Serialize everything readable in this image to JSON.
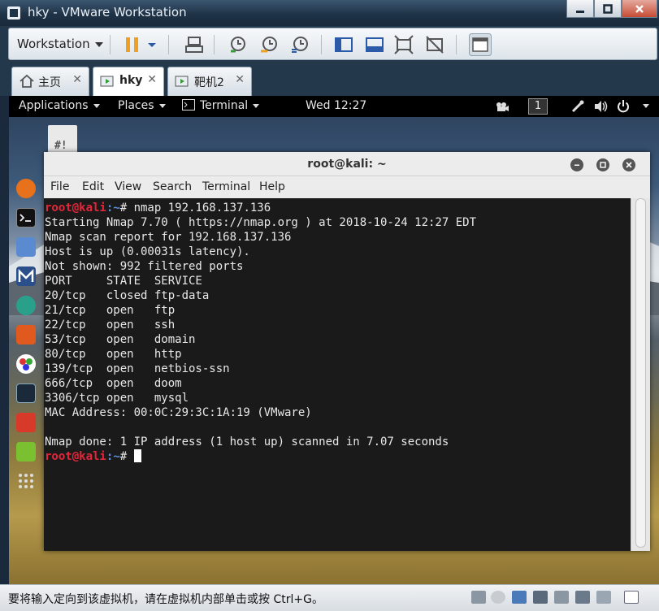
{
  "window": {
    "title": "hky - VMware Workstation"
  },
  "toolbar": {
    "workstation_label": "Workstation"
  },
  "tabs": [
    {
      "label": "主页",
      "close": "✕"
    },
    {
      "label": "hky",
      "close": "✕"
    },
    {
      "label": "靶机2",
      "close": "✕"
    }
  ],
  "gnome": {
    "applications": "Applications",
    "places": "Places",
    "terminal": "Terminal",
    "clock": "Wed 12:27",
    "workspace": "1"
  },
  "desktop": {
    "file_label": "#!"
  },
  "terminal": {
    "title": "root@kali: ~",
    "menu": [
      "File",
      "Edit",
      "View",
      "Search",
      "Terminal",
      "Help"
    ],
    "prompt_user": "root@kali",
    "prompt_path": ":~",
    "prompt_symbol": "# ",
    "command": "nmap 192.168.137.136",
    "output": [
      "Starting Nmap 7.70 ( https://nmap.org ) at 2018-10-24 12:27 EDT",
      "Nmap scan report for 192.168.137.136",
      "Host is up (0.00031s latency).",
      "Not shown: 992 filtered ports",
      "PORT     STATE  SERVICE",
      "20/tcp   closed ftp-data",
      "21/tcp   open   ftp",
      "22/tcp   open   ssh",
      "53/tcp   open   domain",
      "80/tcp   open   http",
      "139/tcp  open   netbios-ssn",
      "666/tcp  open   doom",
      "3306/tcp open   mysql",
      "MAC Address: 00:0C:29:3C:1A:19 (VMware)",
      "",
      "Nmap done: 1 IP address (1 host up) scanned in 7.07 seconds"
    ]
  },
  "status": {
    "message": "要将输入定向到该虚拟机，请在虚拟机内部单击或按 Ctrl+G。"
  },
  "colors": {
    "prompt_user": "#e5263a",
    "prompt_path": "#5c8fd6",
    "vm_chrome": "#24384c"
  }
}
